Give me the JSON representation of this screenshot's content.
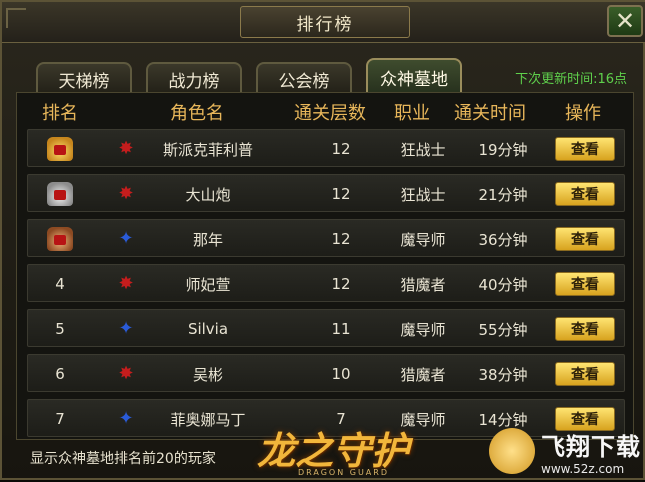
{
  "window": {
    "title": "排行榜",
    "close_label": "✕"
  },
  "tabs": [
    {
      "label": "天梯榜"
    },
    {
      "label": "战力榜"
    },
    {
      "label": "公会榜"
    },
    {
      "label": "众神墓地",
      "active": true
    }
  ],
  "update_text": "下次更新时间:16点",
  "table": {
    "headers": [
      "排名",
      "角色名",
      "通关层数",
      "职业",
      "通关时间",
      "操作"
    ],
    "rows": [
      {
        "rank": "",
        "rank_icon": "gold-crown",
        "class_icon": "red-star",
        "name": "斯派克菲利普",
        "floors": "12",
        "job": "狂战士",
        "time": "19分钟",
        "action": "查看"
      },
      {
        "rank": "",
        "rank_icon": "silver-crown",
        "class_icon": "red-star",
        "name": "大山炮",
        "floors": "12",
        "job": "狂战士",
        "time": "21分钟",
        "action": "查看"
      },
      {
        "rank": "",
        "rank_icon": "bronze-crown",
        "class_icon": "blue-wings",
        "name": "那年",
        "floors": "12",
        "job": "魔导师",
        "time": "36分钟",
        "action": "查看"
      },
      {
        "rank": "4",
        "rank_icon": "",
        "class_icon": "red-star",
        "name": "师妃萱",
        "floors": "12",
        "job": "猎魔者",
        "time": "40分钟",
        "action": "查看"
      },
      {
        "rank": "5",
        "rank_icon": "",
        "class_icon": "blue-wings",
        "name": "Silvia",
        "floors": "11",
        "job": "魔导师",
        "time": "55分钟",
        "action": "查看"
      },
      {
        "rank": "6",
        "rank_icon": "",
        "class_icon": "red-star",
        "name": "吴彬",
        "floors": "10",
        "job": "猎魔者",
        "time": "38分钟",
        "action": "查看"
      },
      {
        "rank": "7",
        "rank_icon": "",
        "class_icon": "blue-wings",
        "name": "菲奥娜马丁",
        "floors": "7",
        "job": "魔导师",
        "time": "14分钟",
        "action": "查看"
      }
    ]
  },
  "footer_text": "显示众神墓地排名前20的玩家",
  "logo": {
    "title": "龙之守护",
    "subtitle": "DRAGON GUARD"
  },
  "watermark": {
    "title": "飞翔下载",
    "url": "www.52z.com"
  },
  "colors": {
    "header_text": "#e7b65a",
    "update_text": "#5fd14c",
    "button": "#d7a21e",
    "red_class_icon": "#c51d1d",
    "blue_class_icon": "#2a5bd8"
  }
}
